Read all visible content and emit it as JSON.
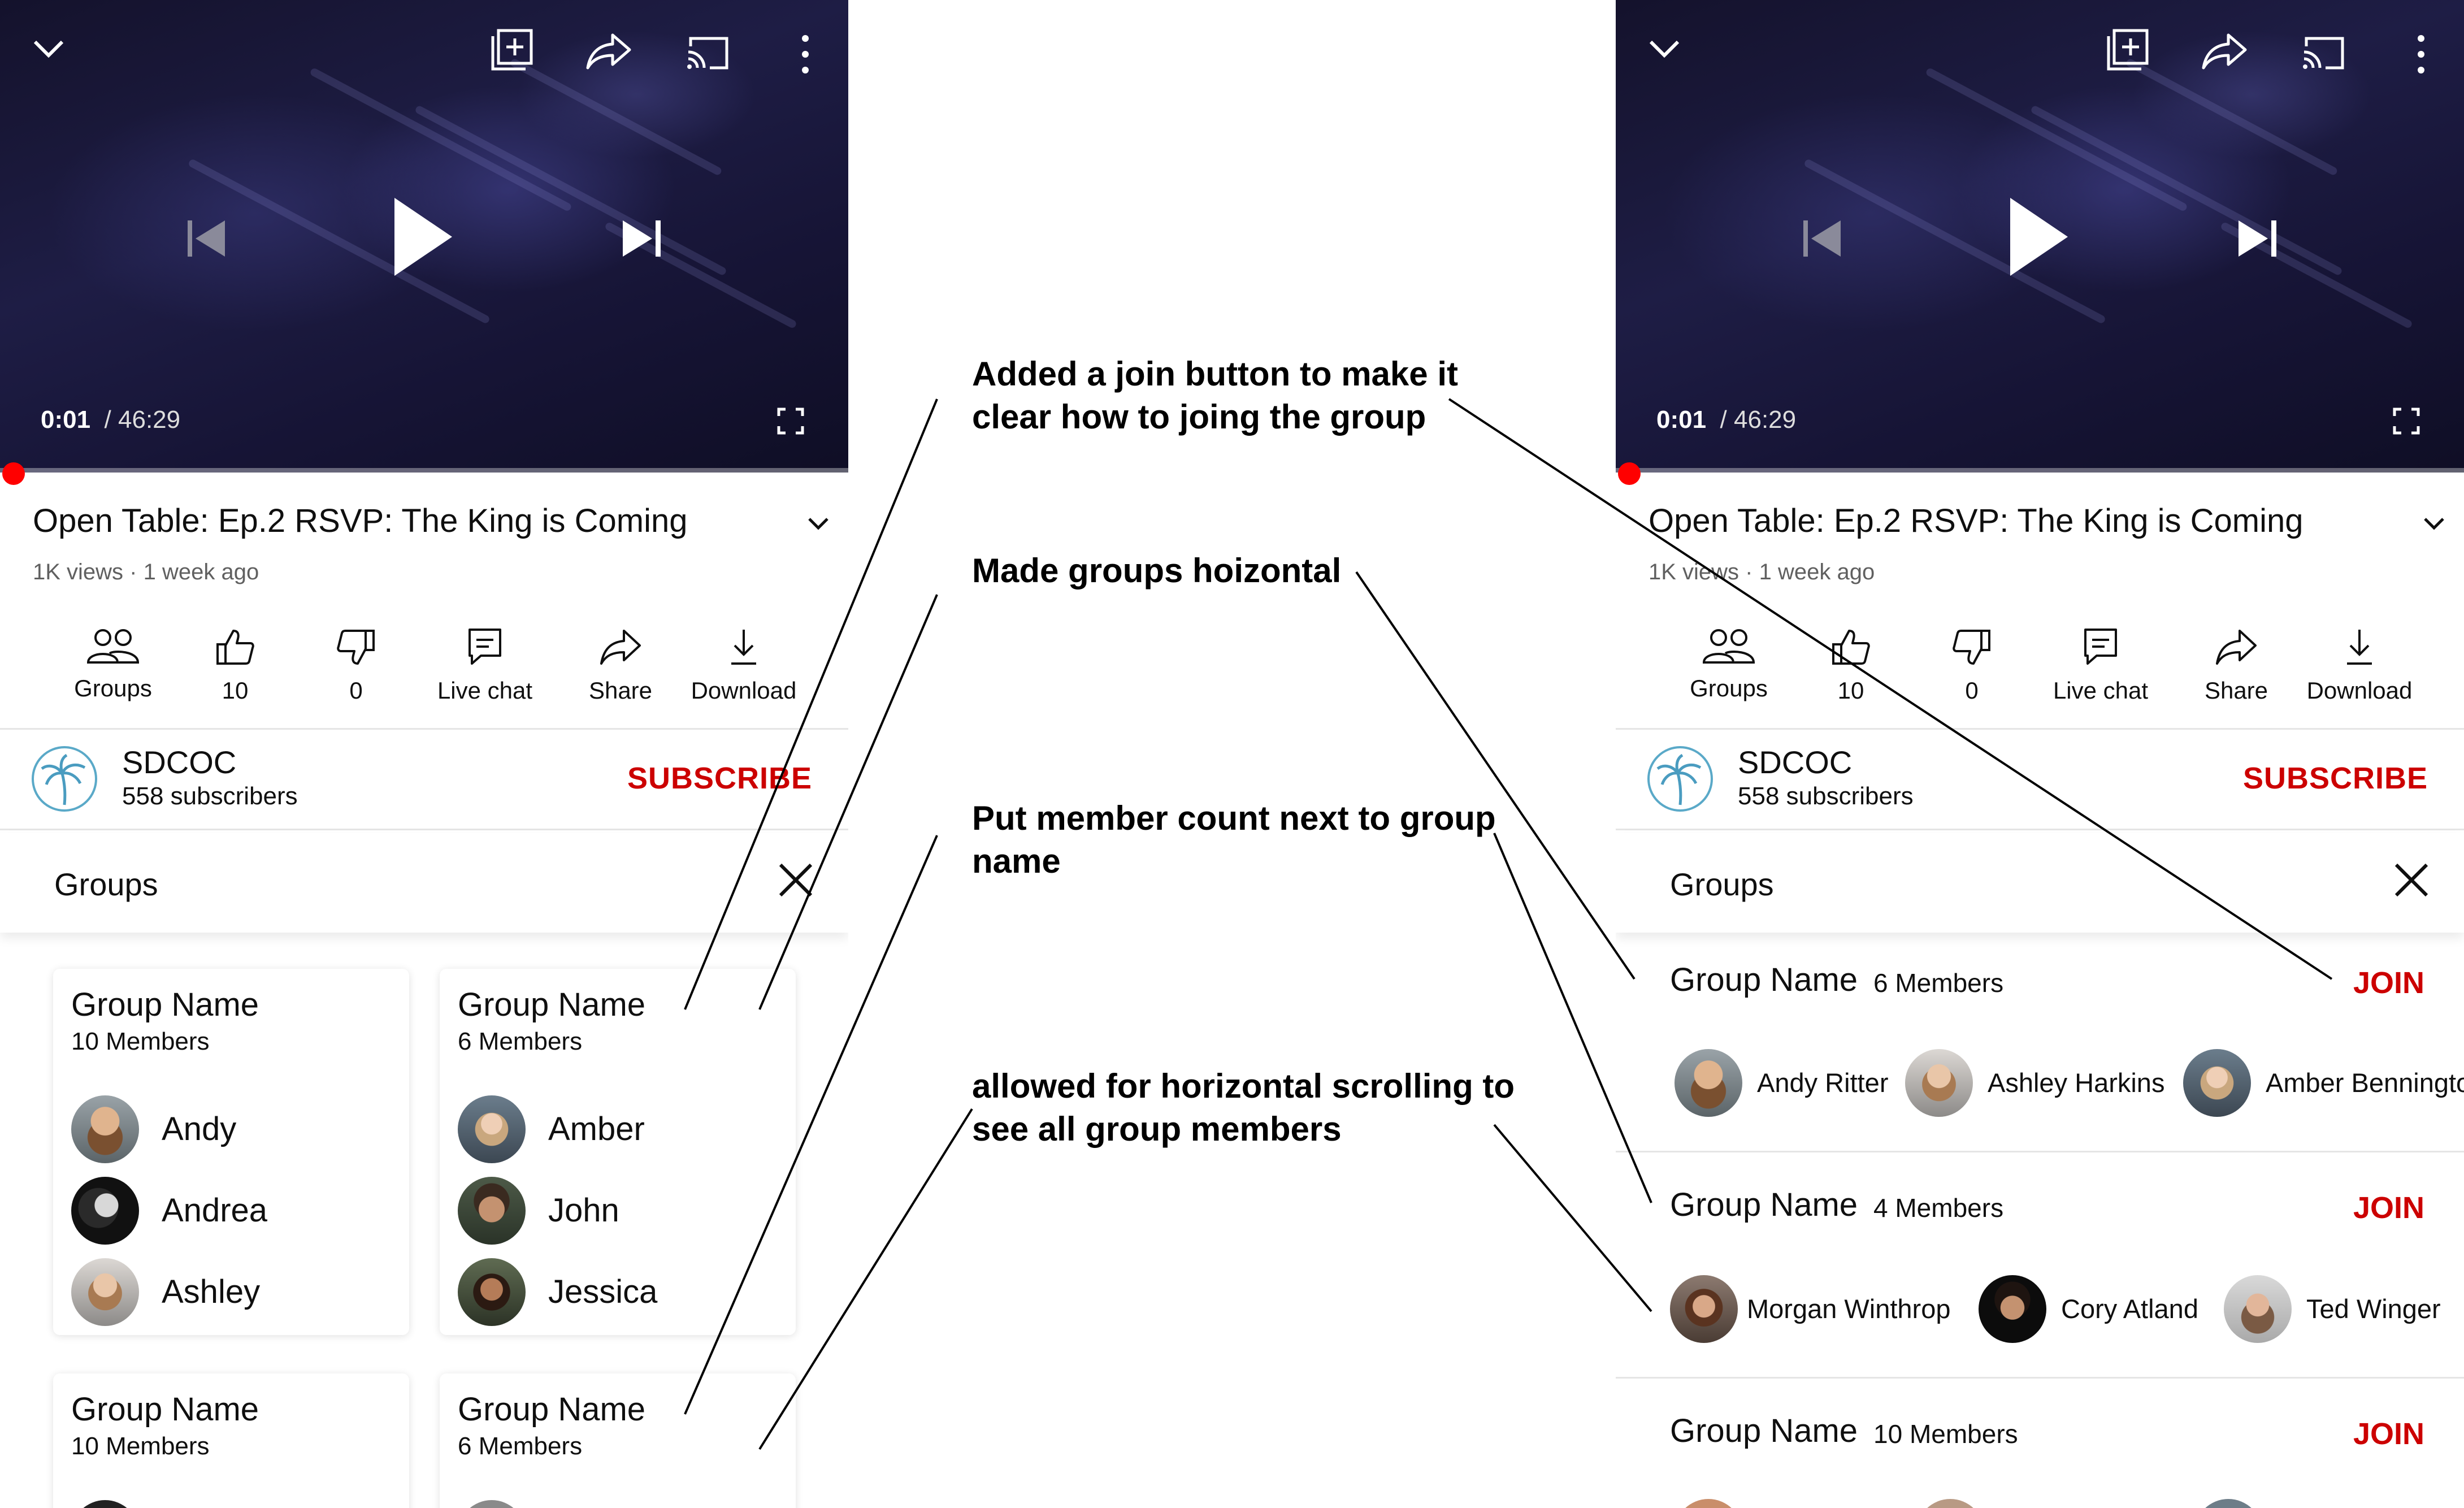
{
  "player": {
    "current_time": "0:01",
    "separator": "/",
    "total_time": "46:29"
  },
  "video": {
    "title": "Open Table: Ep.2 RSVP: The King is Coming",
    "meta": "1K views · 1 week ago"
  },
  "actions": [
    {
      "label": "Groups",
      "icon": "groups-icon"
    },
    {
      "label": "10",
      "icon": "thumbs-up-icon"
    },
    {
      "label": "0",
      "icon": "thumbs-down-icon"
    },
    {
      "label": "Live chat",
      "icon": "chat-icon"
    },
    {
      "label": "Share",
      "icon": "share-icon"
    },
    {
      "label": "Download",
      "icon": "download-icon"
    }
  ],
  "channel": {
    "name": "SDCOC",
    "subscribers": "558 subscribers",
    "subscribe_label": "SUBSCRIBE"
  },
  "groups_panel": {
    "title": "Groups"
  },
  "left_cards": [
    {
      "name": "Group Name",
      "count": "10 Members",
      "members": [
        "Andy",
        "Andrea",
        "Ashley"
      ]
    },
    {
      "name": "Group Name",
      "count": "6 Members",
      "members": [
        "Amber",
        "John",
        "Jessica"
      ]
    },
    {
      "name": "Group Name",
      "count": "10 Members",
      "members": []
    },
    {
      "name": "Group Name",
      "count": "6 Members",
      "members": []
    }
  ],
  "right_groups": [
    {
      "name": "Group Name",
      "count": "6 Members",
      "join": "JOIN",
      "members": [
        "Andy Ritter",
        "Ashley Harkins",
        "Amber Benningto"
      ]
    },
    {
      "name": "Group Name",
      "count": "4 Members",
      "join": "JOIN",
      "members": [
        "Morgan Winthrop",
        "Cory Atland",
        "Ted Winger"
      ]
    },
    {
      "name": "Group Name",
      "count": "10 Members",
      "join": "JOIN",
      "members": []
    }
  ],
  "annotations": [
    "Added a join button to make it clear how to joing the group",
    "Made groups hoizontal",
    "Put member count next to group name",
    "allowed for horizontal scrolling to see all group members"
  ],
  "colors": {
    "accent_red": "#cc0000",
    "progress_red": "#ff0000",
    "player_bg": "#1a1938"
  }
}
